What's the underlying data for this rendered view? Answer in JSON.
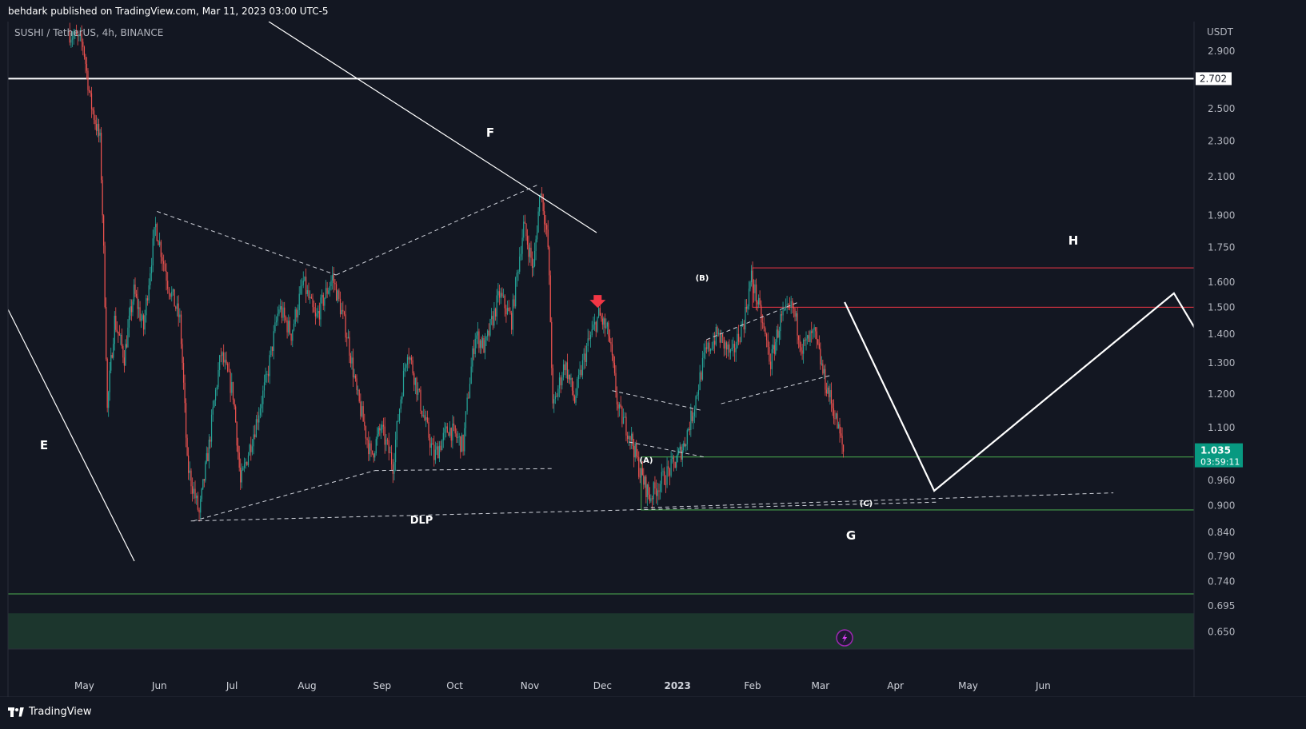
{
  "header": {
    "publisher_line": "behdark published on TradingView.com, Mar 11, 2023 03:00 UTC-5"
  },
  "symbol": {
    "line": "SUSHI / TetherUS, 4h, BINANCE"
  },
  "footer": {
    "brand": "TradingView"
  },
  "colors": {
    "background": "#131722",
    "bull_candle": "#26a69a",
    "bear_candle": "#ef5350",
    "zone_green": "#4caf50",
    "zone_red": "#f23645",
    "price_badge": "#089981",
    "arrow": "#f23645"
  },
  "chart_data": {
    "type": "candlestick",
    "title": "",
    "xlabel": "",
    "ylabel": "USDT",
    "y_scale": "log",
    "ylim": [
      0.622,
      3.13
    ],
    "x_ticks": [
      "May",
      "Jun",
      "Jul",
      "Aug",
      "Sep",
      "Oct",
      "Nov",
      "Dec",
      "2023",
      "Feb",
      "Mar",
      "Apr",
      "May",
      "Jun"
    ],
    "y_ticks": [
      "2.900",
      "2.500",
      "2.300",
      "2.100",
      "1.900",
      "1.750",
      "1.600",
      "1.500",
      "1.400",
      "1.300",
      "1.200",
      "1.100",
      "0.960",
      "0.900",
      "0.840",
      "0.790",
      "0.740",
      "0.695",
      "0.650"
    ],
    "price_labels": {
      "line_level": "2.702",
      "last_price": "1.035",
      "countdown": "03:59:11"
    },
    "price_path": [
      [
        "2022-04-25",
        3.05
      ],
      [
        "2022-05-01",
        2.95
      ],
      [
        "2022-05-04",
        2.55
      ],
      [
        "2022-05-08",
        2.3
      ],
      [
        "2022-05-11",
        1.15
      ],
      [
        "2022-05-14",
        1.45
      ],
      [
        "2022-05-18",
        1.32
      ],
      [
        "2022-05-22",
        1.56
      ],
      [
        "2022-05-26",
        1.42
      ],
      [
        "2022-05-31",
        1.85
      ],
      [
        "2022-06-05",
        1.6
      ],
      [
        "2022-06-10",
        1.45
      ],
      [
        "2022-06-13",
        1.0
      ],
      [
        "2022-06-18",
        0.88
      ],
      [
        "2022-06-22",
        1.05
      ],
      [
        "2022-06-27",
        1.33
      ],
      [
        "2022-07-02",
        1.2
      ],
      [
        "2022-07-05",
        0.95
      ],
      [
        "2022-07-11",
        1.1
      ],
      [
        "2022-07-16",
        1.25
      ],
      [
        "2022-07-21",
        1.5
      ],
      [
        "2022-07-26",
        1.4
      ],
      [
        "2022-07-31",
        1.6
      ],
      [
        "2022-08-05",
        1.45
      ],
      [
        "2022-08-12",
        1.62
      ],
      [
        "2022-08-18",
        1.4
      ],
      [
        "2022-08-22",
        1.2
      ],
      [
        "2022-08-28",
        1.02
      ],
      [
        "2022-09-01",
        1.1
      ],
      [
        "2022-09-06",
        1.0
      ],
      [
        "2022-09-12",
        1.35
      ],
      [
        "2022-09-18",
        1.15
      ],
      [
        "2022-09-23",
        1.02
      ],
      [
        "2022-09-29",
        1.1
      ],
      [
        "2022-10-05",
        1.05
      ],
      [
        "2022-10-10",
        1.4
      ],
      [
        "2022-10-14",
        1.35
      ],
      [
        "2022-10-20",
        1.55
      ],
      [
        "2022-10-25",
        1.45
      ],
      [
        "2022-10-30",
        1.85
      ],
      [
        "2022-11-03",
        1.65
      ],
      [
        "2022-11-06",
        2.05
      ],
      [
        "2022-11-09",
        1.75
      ],
      [
        "2022-11-11",
        1.15
      ],
      [
        "2022-11-16",
        1.3
      ],
      [
        "2022-11-20",
        1.18
      ],
      [
        "2022-11-25",
        1.35
      ],
      [
        "2022-11-30",
        1.47
      ],
      [
        "2022-12-04",
        1.4
      ],
      [
        "2022-12-08",
        1.15
      ],
      [
        "2022-12-13",
        1.08
      ],
      [
        "2022-12-17",
        0.98
      ],
      [
        "2022-12-21",
        0.92
      ],
      [
        "2022-12-26",
        0.96
      ],
      [
        "2022-12-31",
        1.0
      ],
      [
        "2023-01-04",
        1.05
      ],
      [
        "2023-01-08",
        1.15
      ],
      [
        "2023-01-13",
        1.33
      ],
      [
        "2023-01-18",
        1.4
      ],
      [
        "2023-01-24",
        1.32
      ],
      [
        "2023-01-29",
        1.45
      ],
      [
        "2023-02-01",
        1.62
      ],
      [
        "2023-02-04",
        1.5
      ],
      [
        "2023-02-09",
        1.3
      ],
      [
        "2023-02-13",
        1.45
      ],
      [
        "2023-02-18",
        1.5
      ],
      [
        "2023-02-22",
        1.35
      ],
      [
        "2023-02-27",
        1.4
      ],
      [
        "2023-03-03",
        1.25
      ],
      [
        "2023-03-07",
        1.15
      ],
      [
        "2023-03-11",
        1.035
      ]
    ],
    "annotations": {
      "wave_labels": [
        "E",
        "F",
        "G",
        "H",
        "DLP",
        "(A)",
        "(B)",
        "(C)"
      ]
    }
  }
}
